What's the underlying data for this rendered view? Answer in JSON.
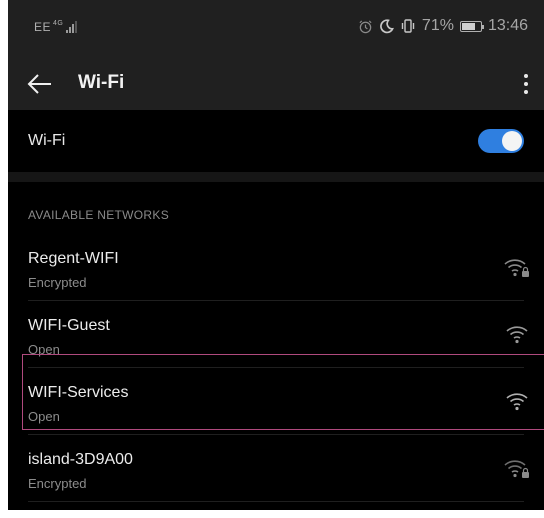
{
  "status_bar": {
    "carrier": "EE",
    "network_type": "4G",
    "battery_percent": "71%",
    "battery_level": 0.71,
    "time": "13:46",
    "icons": [
      "alarm-icon",
      "do-not-disturb-moon-icon",
      "vibrate-icon",
      "battery-icon"
    ]
  },
  "app_bar": {
    "title": "Wi-Fi",
    "back_icon": "arrow-left-icon",
    "menu_icon": "more-vertical-icon"
  },
  "wifi_toggle": {
    "label": "Wi-Fi",
    "enabled": true,
    "accent_color": "#2f7fe0"
  },
  "available_networks": {
    "header": "AVAILABLE NETWORKS",
    "items": [
      {
        "name": "Regent-WIFI",
        "status": "Encrypted",
        "secured": true
      },
      {
        "name": "WIFI-Guest",
        "status": "Open",
        "secured": false
      },
      {
        "name": "WIFI-Services",
        "status": "Open",
        "secured": false,
        "highlighted": true
      },
      {
        "name": "island-3D9A00",
        "status": "Encrypted",
        "secured": true
      }
    ]
  },
  "highlight_color": "#b04a7e"
}
